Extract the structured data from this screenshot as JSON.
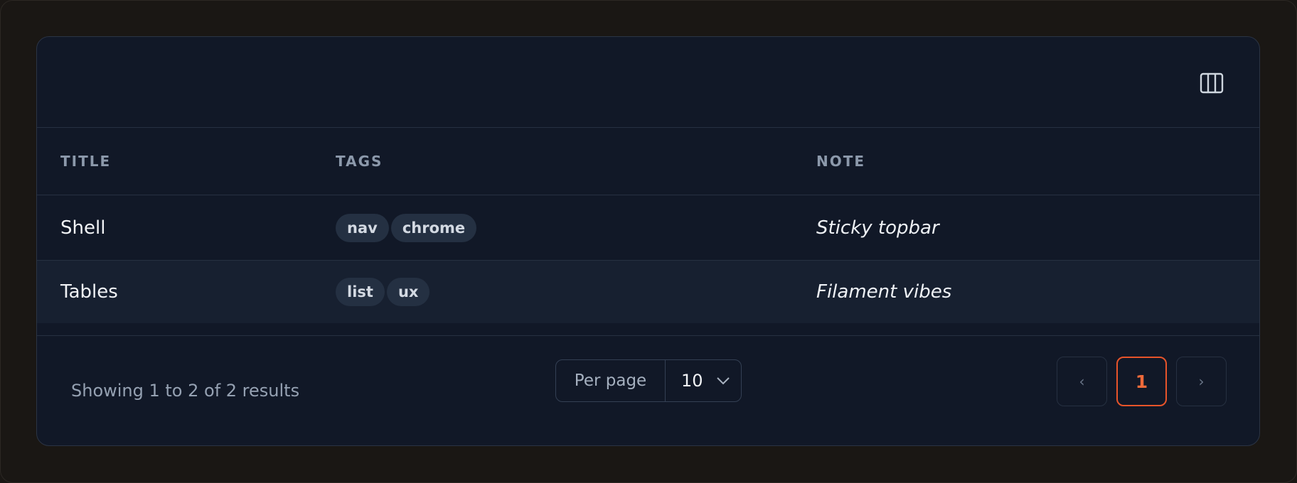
{
  "table": {
    "columns": [
      "Title",
      "Tags",
      "Note"
    ],
    "rows": [
      {
        "title": "Shell",
        "tags": [
          "nav",
          "chrome"
        ],
        "note": "Sticky topbar"
      },
      {
        "title": "Tables",
        "tags": [
          "list",
          "ux"
        ],
        "note": "Filament vibes"
      }
    ]
  },
  "toolbar": {
    "columns_toggle_icon": "columns-icon"
  },
  "footer": {
    "summary": "Showing 1 to 2 of 2 results",
    "per_page_label": "Per page",
    "per_page_value": "10",
    "prev_label": "‹",
    "current_page": "1",
    "next_label": "›"
  },
  "colors": {
    "background": "#1a1714",
    "card": "#111827",
    "accent": "#e8542a",
    "tag_bg": "#243042"
  }
}
